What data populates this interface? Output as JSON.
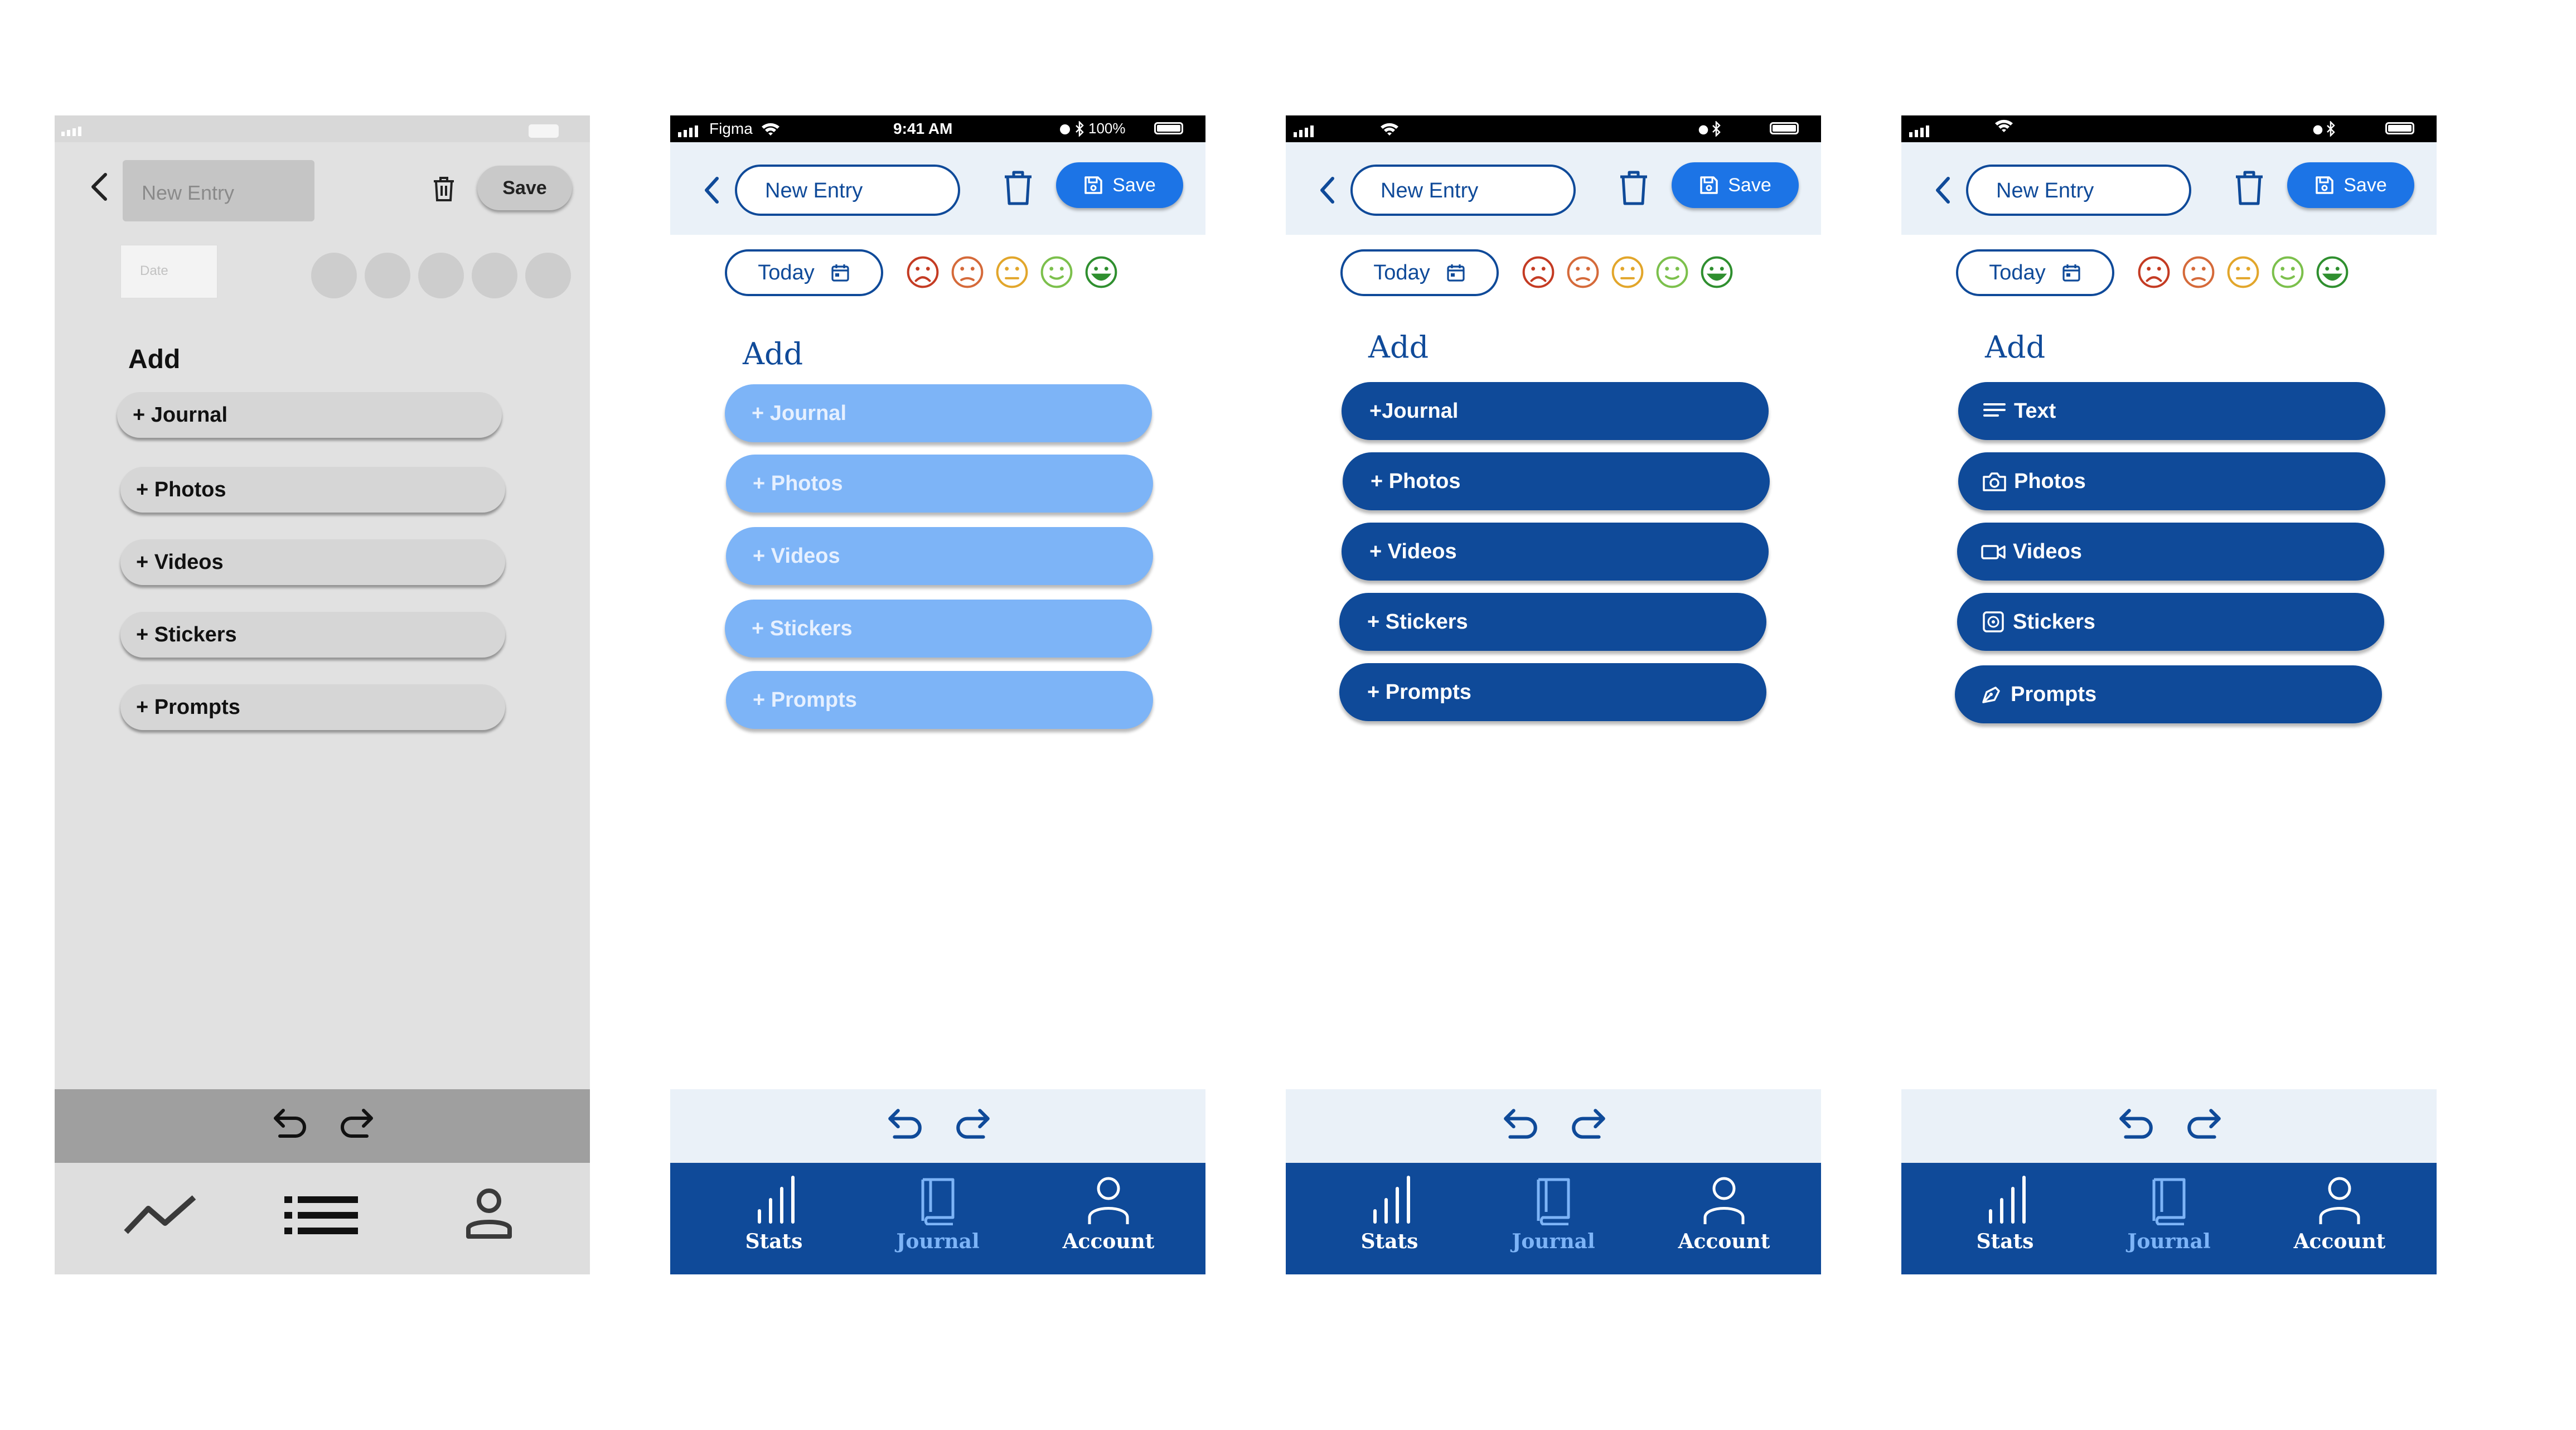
{
  "wireframe": {
    "header": {
      "title_placeholder": "New Entry",
      "save_label": "Save"
    },
    "date_placeholder": "Date",
    "add_label": "Add",
    "add_items": [
      "+ Journal",
      "+ Photos",
      "+ Videos",
      "+ Stickers",
      "+ Prompts"
    ],
    "tab_icons": [
      "trend-line-icon",
      "list-icon",
      "person-icon"
    ]
  },
  "screens": [
    {
      "status": {
        "carrier": "Figma",
        "time": "9:41 AM",
        "battery": "100%"
      },
      "header": {
        "title_placeholder": "New Entry",
        "save_label": "Save"
      },
      "date_label": "Today",
      "add_label": "Add",
      "add_items": [
        "+ Journal",
        "+ Photos",
        "+ Videos",
        "+ Stickers",
        "+ Prompts"
      ],
      "tabs": [
        "Stats",
        "Journal",
        "Account"
      ]
    },
    {
      "header": {
        "title_placeholder": "New Entry",
        "save_label": "Save"
      },
      "date_label": "Today",
      "add_label": "Add",
      "add_items": [
        "+Journal",
        "+ Photos",
        "+ Videos",
        "+ Stickers",
        "+ Prompts"
      ],
      "tabs": [
        "Stats",
        "Journal",
        "Account"
      ]
    },
    {
      "header": {
        "title_placeholder": "New Entry",
        "save_label": "Save"
      },
      "date_label": "Today",
      "add_label": "Add",
      "add_items": [
        "Text",
        "Photos",
        "Videos",
        "Stickers",
        "Prompts"
      ],
      "add_item_icons": [
        "text-lines-icon",
        "camera-icon",
        "video-camera-icon",
        "sticker-icon",
        "pen-nib-icon"
      ],
      "tabs": [
        "Stats",
        "Journal",
        "Account"
      ]
    }
  ],
  "colors": {
    "brand_navy": "#0f4a99",
    "save_blue": "#1c74e6",
    "light_blue": "#7db4f7",
    "header_bg": "#eaf1f8",
    "mood_colors": [
      "#c43b23",
      "#d56a3a",
      "#e2a62b",
      "#7cc04c",
      "#2f8f2f"
    ]
  },
  "mood_icons": [
    "very-sad-face-icon",
    "sad-face-icon",
    "neutral-face-icon",
    "smile-face-icon",
    "very-happy-face-icon"
  ]
}
